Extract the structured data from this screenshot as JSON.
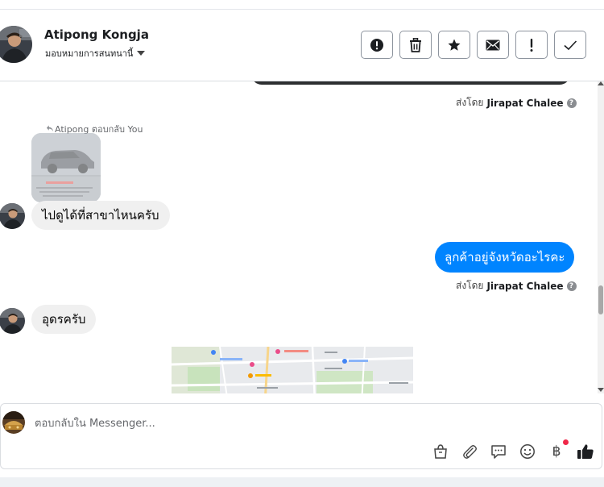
{
  "header": {
    "name": "Atipong Kongja",
    "assign_label": "มอบหมายการสนทนานี้"
  },
  "thread": {
    "sent_by_prefix": "ส่งโดย",
    "agent_name": "Jirapat Chalee",
    "reply_note": "Atipong ตอบกลับ You",
    "messages": [
      {
        "from": "customer",
        "text": "ไปดูได้ที่สาขาไหนครับ"
      },
      {
        "from": "page",
        "text": "ลูกค้าอยู่จังหวัดอะไรคะ"
      },
      {
        "from": "customer",
        "text": "อุดรครับ"
      }
    ]
  },
  "composer": {
    "placeholder": "ตอบกลับใน Messenger..."
  },
  "icons": {
    "header_actions": [
      "alert-circle-icon",
      "trash-icon",
      "star-icon",
      "mail-icon",
      "exclamation-icon",
      "check-icon"
    ],
    "composer_tools": [
      "shopping-bag-icon",
      "paperclip-icon",
      "chat-bubble-icon",
      "emoji-icon",
      "baht-icon",
      "thumbs-up-icon"
    ]
  },
  "colors": {
    "accent": "#0084ff",
    "incoming_bubble": "#f0f0f0",
    "notification_dot": "#f02849"
  }
}
